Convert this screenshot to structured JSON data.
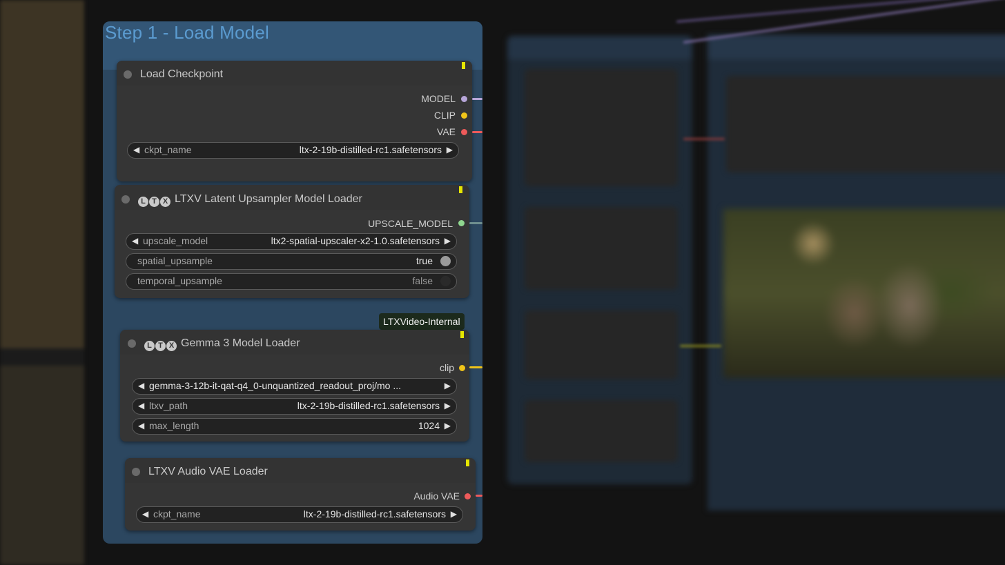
{
  "group": {
    "title": "Step 1 - Load Model"
  },
  "nodes": {
    "load_checkpoint": {
      "title": "Load Checkpoint",
      "outputs": [
        "MODEL",
        "CLIP",
        "VAE"
      ],
      "widgets": {
        "ckpt_name": {
          "name": "ckpt_name",
          "value": "ltx-2-19b-distilled-rc1.safetensors"
        }
      }
    },
    "upsampler": {
      "badges": [
        "L",
        "T",
        "X"
      ],
      "title": "LTXV Latent Upsampler Model Loader",
      "outputs": [
        "UPSCALE_MODEL"
      ],
      "widgets": {
        "upscale_model": {
          "name": "upscale_model",
          "value": "ltx2-spatial-upscaler-x2-1.0.safetensors"
        },
        "spatial_upsample": {
          "name": "spatial_upsample",
          "value": "true"
        },
        "temporal_upsample": {
          "name": "temporal_upsample",
          "value": "false"
        }
      }
    },
    "gemma": {
      "tag": "LTXVideo-Internal",
      "badges": [
        "L",
        "T",
        "X"
      ],
      "title": "Gemma 3 Model Loader",
      "outputs": [
        "clip"
      ],
      "widgets": {
        "gemma_path": {
          "value": "gemma-3-12b-it-qat-q4_0-unquantized_readout_proj/mo ..."
        },
        "ltxv_path": {
          "name": "ltxv_path",
          "value": "ltx-2-19b-distilled-rc1.safetensors"
        },
        "max_length": {
          "name": "max_length",
          "value": "1024"
        }
      }
    },
    "audio_vae": {
      "title": "LTXV Audio VAE Loader",
      "outputs": [
        "Audio VAE"
      ],
      "widgets": {
        "ckpt_name": {
          "name": "ckpt_name",
          "value": "ltx-2-19b-distilled-rc1.safetensors"
        }
      }
    }
  },
  "icons": {
    "left_arrow": "◀",
    "right_arrow": "▶"
  },
  "colors": {
    "group_bg": "#2c4760",
    "group_title": "#5b9bd0",
    "model": "#b7a6d9",
    "clip": "#f0c419",
    "vae": "#ee5a5a",
    "upscale_model": "#8fd68f",
    "audio_vae": "#ee5a5a"
  }
}
